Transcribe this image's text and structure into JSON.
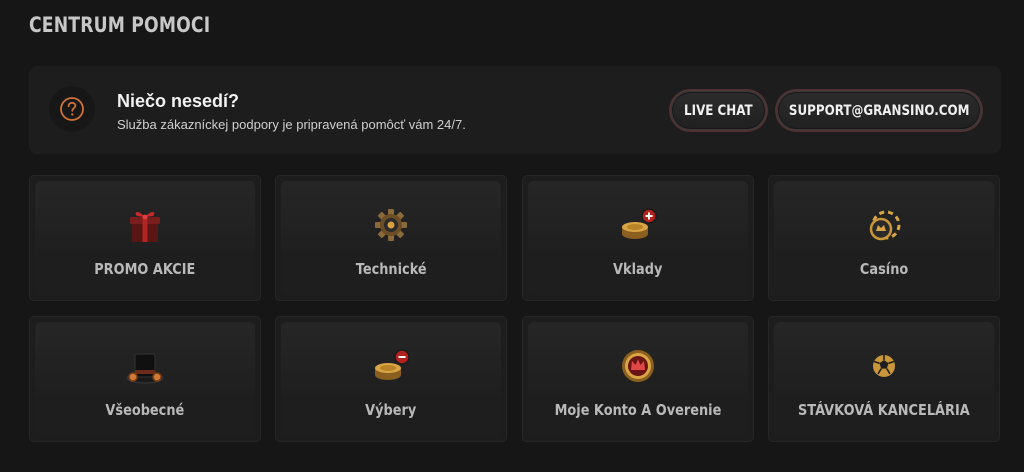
{
  "header": {
    "title": "CENTRUM POMOCI"
  },
  "support": {
    "heading": "Niečo nesedí?",
    "subtext": "Služba zákazníckej podpory je pripravená pomôcť vám 24/7.",
    "live_chat_label": "LIVE CHAT",
    "email_label": "SUPPORT@GRANSINO.COM",
    "accent_color": "#d0733a"
  },
  "categories": [
    {
      "label": "PROMO AKCIE",
      "icon": "gift-icon"
    },
    {
      "label": "Technické",
      "icon": "gear-icon"
    },
    {
      "label": "Vklady",
      "icon": "coins-plus-icon"
    },
    {
      "label": "Casíno",
      "icon": "casino-chips-icon"
    },
    {
      "label": "Všeobecné",
      "icon": "top-hat-icon"
    },
    {
      "label": "Výbery",
      "icon": "coins-minus-icon"
    },
    {
      "label": "Moje Konto A Overenie",
      "icon": "crown-badge-icon"
    },
    {
      "label": "STÁVKOVÁ KANCELÁRIA",
      "icon": "soccer-ball-icon"
    }
  ]
}
